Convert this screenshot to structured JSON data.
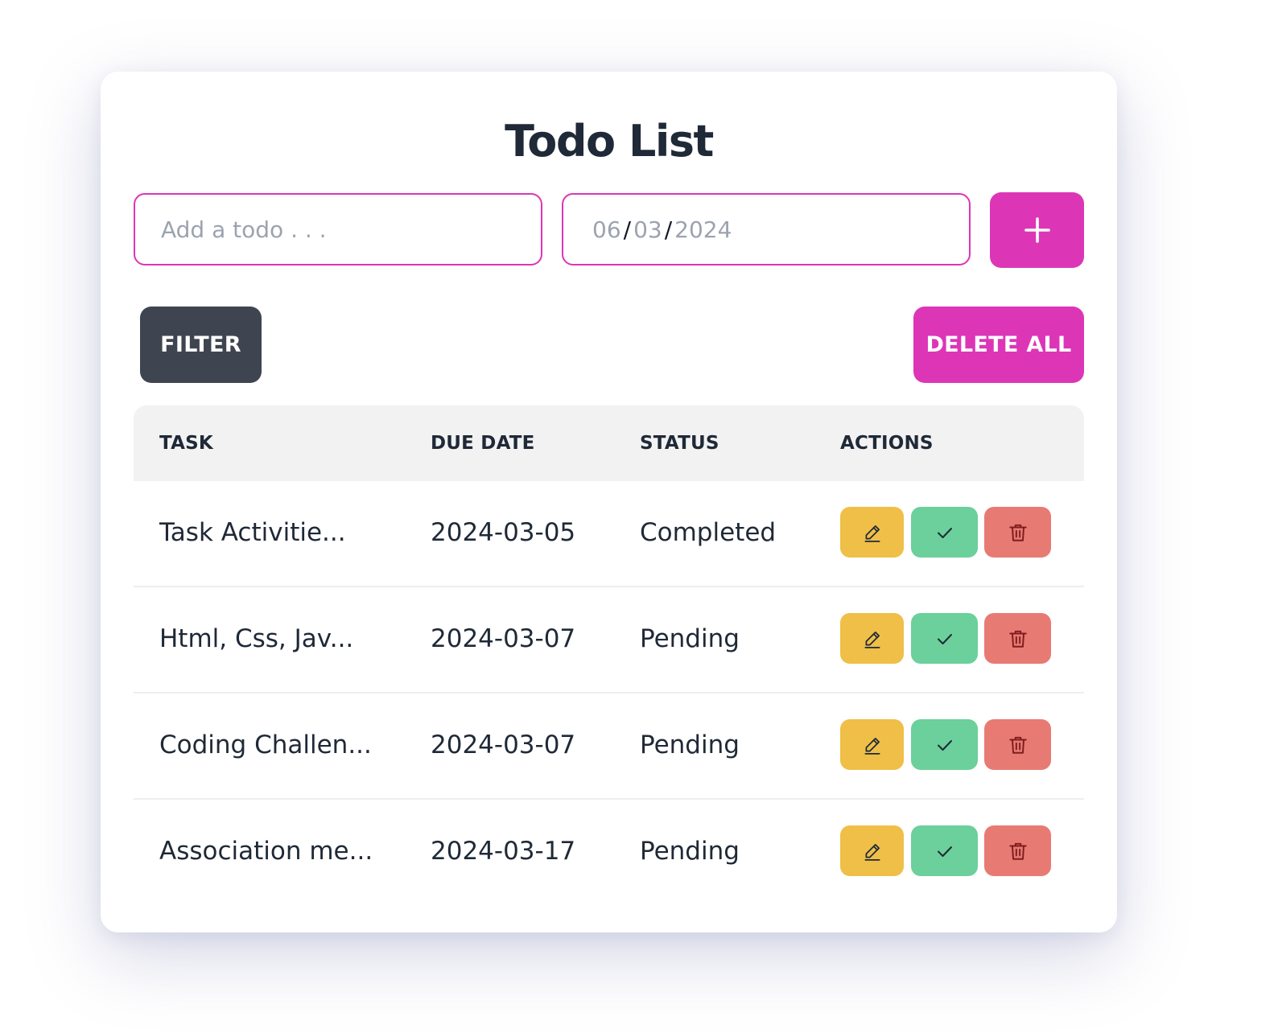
{
  "app": {
    "title": "Todo List"
  },
  "form": {
    "todo_placeholder": "Add a todo . . .",
    "date_month": "06",
    "date_day": "03",
    "date_year": "2024",
    "date_separator": "/",
    "add_icon": "plus-icon"
  },
  "toolbar": {
    "filter_label": "FILTER",
    "delete_all_label": "DELETE ALL"
  },
  "table": {
    "headers": [
      "TASK",
      "DUE DATE",
      "STATUS",
      "ACTIONS"
    ],
    "rows": [
      {
        "task": "Task Activitie...",
        "due_date": "2024-03-05",
        "status": "Completed"
      },
      {
        "task": "Html, Css, Jav...",
        "due_date": "2024-03-07",
        "status": "Pending"
      },
      {
        "task": "Coding Challen...",
        "due_date": "2024-03-07",
        "status": "Pending"
      },
      {
        "task": "Association me...",
        "due_date": "2024-03-17",
        "status": "Pending"
      }
    ],
    "action_icons": [
      "pencil-icon",
      "check-icon",
      "trash-icon"
    ]
  },
  "colors": {
    "accent": "#dc36b7",
    "filter": "#3f4550",
    "edit": "#f0bf48",
    "complete": "#6bd09b",
    "delete": "#e87a74",
    "text": "#1f2937"
  }
}
